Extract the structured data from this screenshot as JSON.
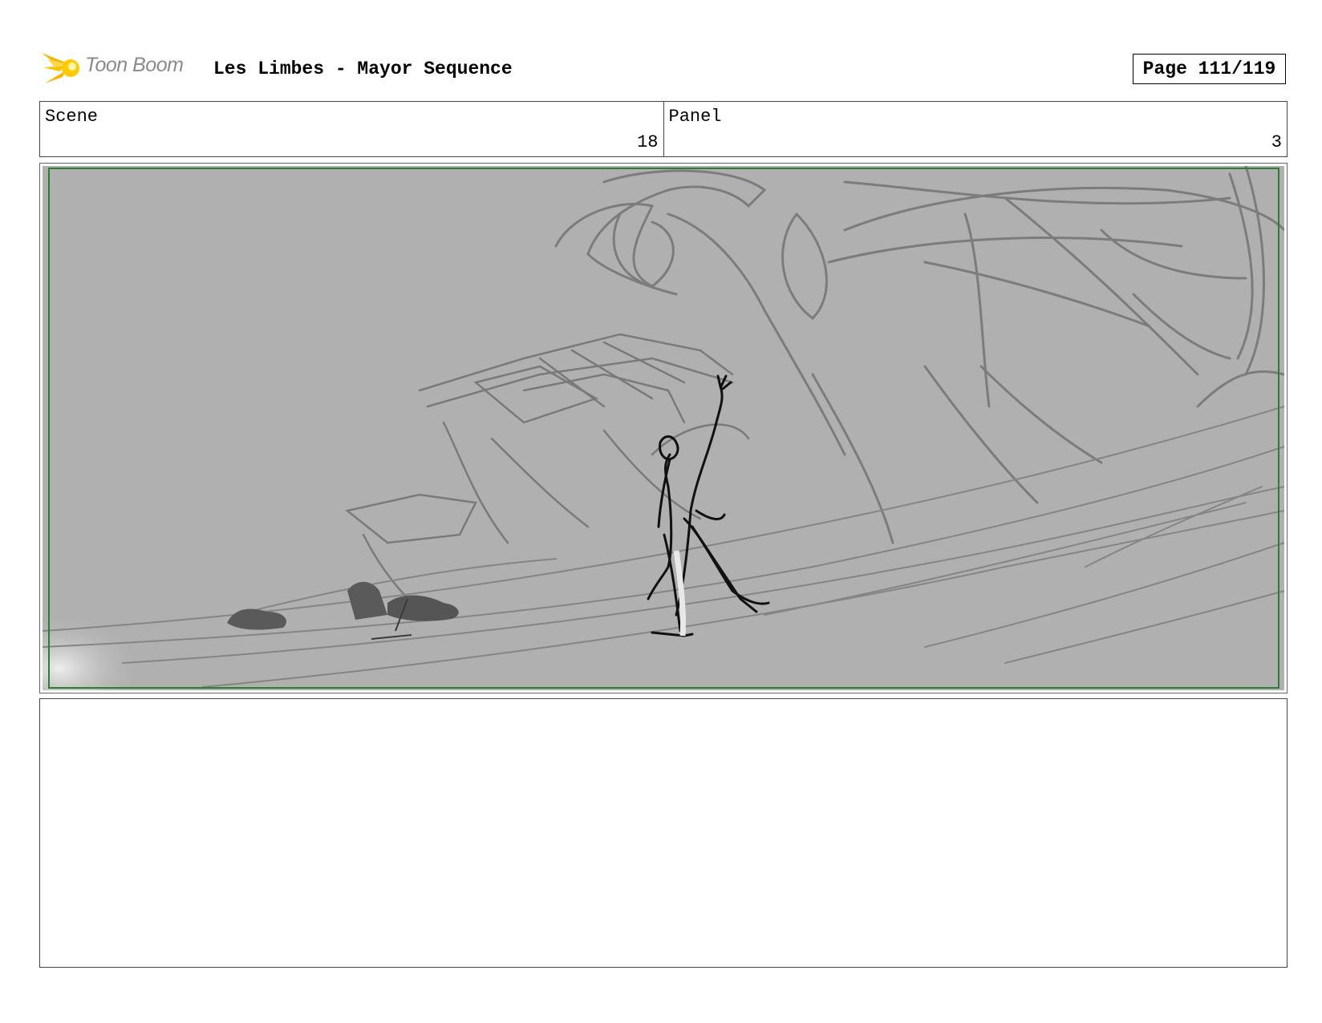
{
  "header": {
    "logo_text": "Toon Boom",
    "title": "Les Limbes - Mayor Sequence",
    "page": "Page 111/119"
  },
  "info": {
    "scene_label": "Scene",
    "scene_value": "18",
    "panel_label": "Panel",
    "panel_value": "3"
  },
  "panel": {
    "safe_frame_color": "#2e7d32",
    "background_color": "#b0b0b0"
  },
  "notes": {
    "text": ""
  }
}
